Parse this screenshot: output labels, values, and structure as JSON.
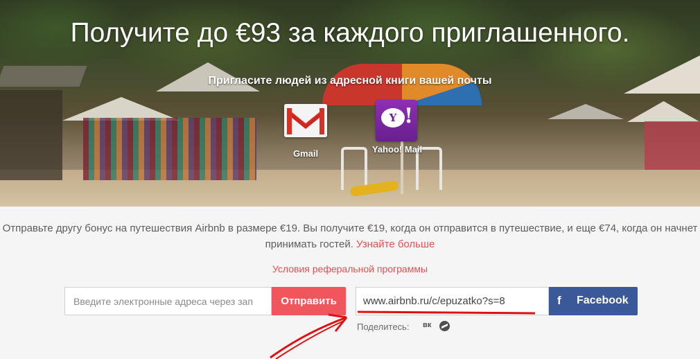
{
  "hero": {
    "title": "Получите до €93 за каждого приглашенного.",
    "subtitle": "Пригласите людей из адресной книги вашей почты",
    "providers": [
      {
        "label": "Gmail",
        "icon": "gmail-icon"
      },
      {
        "label": "Yahoo! Mail",
        "icon": "yahoo-mail-icon"
      }
    ]
  },
  "referral": {
    "description": "Отправьте другу бонус на путешествия Airbnb в размере €19. Вы получите €19, когда он отправится в путешествие, и еще €74, когда он начнет принимать гостей.",
    "learn_more": "Узнайте больше",
    "terms_link": "Условия реферальной программы"
  },
  "invite_form": {
    "email_placeholder": "Введите электронные адреса через зап",
    "send_label": "Отправить"
  },
  "share": {
    "link": "www.airbnb.ru/c/epuzatko?s=8",
    "facebook_label": "Facebook",
    "facebook_icon_letter": "f",
    "share_label": "Поделитесь:",
    "vk_label": "вк",
    "icons": [
      "vk-icon",
      "messenger-icon"
    ]
  },
  "colors": {
    "accent": "#f0575d",
    "link": "#e4504f",
    "facebook": "#3b5998",
    "annotation": "#e01010"
  }
}
